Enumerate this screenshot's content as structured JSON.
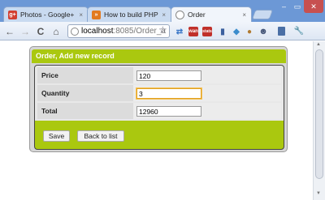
{
  "browser": {
    "tabs": [
      {
        "label": "Photos - Google+",
        "close": "×",
        "icon_text": "g+"
      },
      {
        "label": "How to build PHP co",
        "close": "×",
        "icon_text": "»"
      },
      {
        "label": "Order",
        "close": "×",
        "icon_text": ""
      }
    ],
    "address": {
      "host": "localhost",
      "path": ":8085/Order_a"
    },
    "window_controls": {
      "minimize": "–",
      "maximize": "▭",
      "close": "✕"
    },
    "nav": {
      "back": "←",
      "forward": "→",
      "reload": "C",
      "home": "⌂",
      "star": "☆",
      "wrench": "🔧"
    },
    "extensions": [
      {
        "name": "arrows-icon",
        "text": "⇄",
        "color": "#3c78c8"
      },
      {
        "name": "wan-icon",
        "text": "wan",
        "color": "#c0302a"
      },
      {
        "name": "stats-icon",
        "text": "stats",
        "color": "#c0302a"
      },
      {
        "name": "bag-icon",
        "text": "▮",
        "color": "#3a5f9e"
      },
      {
        "name": "puzzle-icon",
        "text": "◆",
        "color": "#3b8ccc"
      },
      {
        "name": "cookie-icon",
        "text": "●",
        "color": "#b07a30"
      },
      {
        "name": "person-icon",
        "text": "☻",
        "color": "#445577"
      }
    ]
  },
  "form": {
    "title": "Order, Add new record",
    "fields": [
      {
        "label": "Price",
        "value": "120"
      },
      {
        "label": "Quantity",
        "value": "3"
      },
      {
        "label": "Total",
        "value": "12960"
      }
    ],
    "buttons": {
      "save": "Save",
      "back": "Back to list"
    }
  },
  "colors": {
    "accent": "#aac80f",
    "titlebar": "#6c98d6"
  }
}
